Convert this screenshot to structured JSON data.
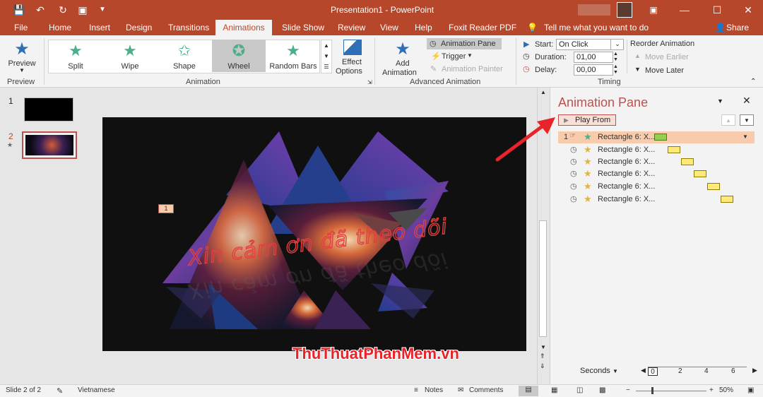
{
  "title_bar": {
    "title": "Presentation1 - PowerPoint"
  },
  "menu": {
    "file": "File",
    "home": "Home",
    "insert": "Insert",
    "design": "Design",
    "transitions": "Transitions",
    "animations": "Animations",
    "slide_show": "Slide Show",
    "review": "Review",
    "view": "View",
    "help": "Help",
    "foxit": "Foxit Reader PDF",
    "tell_me": "Tell me what you want to do",
    "share": "Share"
  },
  "ribbon": {
    "preview_btn": "Preview",
    "preview_group": "Preview",
    "animation_group": "Animation",
    "effects": [
      "Split",
      "Wipe",
      "Shape",
      "Wheel",
      "Random Bars"
    ],
    "selected_effect": "Wheel",
    "effect_options": "Effect Options",
    "effect_options_line1": "Effect",
    "effect_options_line2": "Options",
    "add_animation_line1": "Add",
    "add_animation_line2": "Animation",
    "animation_pane": "Animation Pane",
    "trigger": "Trigger",
    "animation_painter": "Animation Painter",
    "advanced_group": "Advanced Animation",
    "start_label": "Start:",
    "start_value": "On Click",
    "duration_label": "Duration:",
    "duration_value": "01,00",
    "delay_label": "Delay:",
    "delay_value": "00,00",
    "timing_group": "Timing",
    "reorder": "Reorder Animation",
    "move_earlier": "Move Earlier",
    "move_later": "Move Later"
  },
  "slides": [
    {
      "number": "1"
    },
    {
      "number": "2"
    }
  ],
  "slide_content": {
    "caption": "Xin cảm ơn đã theo dõi",
    "anim_tag": "1"
  },
  "watermark": "ThuThuatPhanMem.vn",
  "animation_pane": {
    "title": "Animation Pane",
    "play_from": "Play From",
    "items": [
      {
        "index": "1",
        "label": "Rectangle 6: X...",
        "trigger": "click"
      },
      {
        "index": "",
        "label": "Rectangle 6: X...",
        "trigger": "after"
      },
      {
        "index": "",
        "label": "Rectangle 6: X...",
        "trigger": "after"
      },
      {
        "index": "",
        "label": "Rectangle 6: X...",
        "trigger": "after"
      },
      {
        "index": "",
        "label": "Rectangle 6: X...",
        "trigger": "after"
      },
      {
        "index": "",
        "label": "Rectangle 6: X...",
        "trigger": "after"
      }
    ],
    "seconds": "Seconds",
    "timeline_ticks": [
      "0",
      "2",
      "4",
      "6"
    ]
  },
  "status_bar": {
    "slide_info": "Slide 2 of 2",
    "language": "Vietnamese",
    "notes": "Notes",
    "comments": "Comments",
    "zoom": "50%"
  },
  "colors": {
    "accent": "#b7472a",
    "selected_row": "#f8cbad",
    "bar_green": "#92d050",
    "bar_yellow": "#ffe978",
    "pane_title": "#c0504d"
  }
}
